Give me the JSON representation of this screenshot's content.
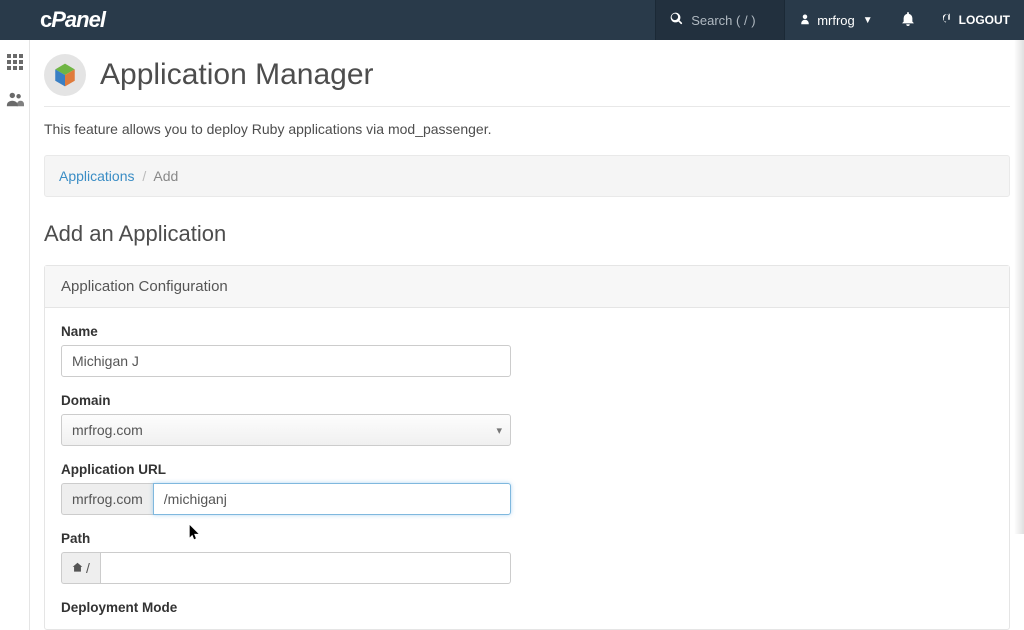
{
  "header": {
    "logo": "cPanel",
    "search_label": "Search",
    "search_shortcut": "( / )",
    "username": "mrfrog",
    "logout": "LOGOUT"
  },
  "page": {
    "title": "Application Manager",
    "description": "This feature allows you to deploy Ruby applications via mod_passenger."
  },
  "breadcrumb": {
    "root": "Applications",
    "current": "Add"
  },
  "section": {
    "title": "Add an Application"
  },
  "panel": {
    "heading": "Application Configuration"
  },
  "form": {
    "name_label": "Name",
    "name_value": "Michigan J",
    "domain_label": "Domain",
    "domain_value": "mrfrog.com",
    "appurl_label": "Application URL",
    "appurl_prefix": "mrfrog.com",
    "appurl_value": "/michiganj",
    "path_label": "Path",
    "path_prefix_home": "⌂",
    "path_prefix_sep": "/",
    "path_value": "",
    "deployment_mode_label": "Deployment Mode"
  }
}
